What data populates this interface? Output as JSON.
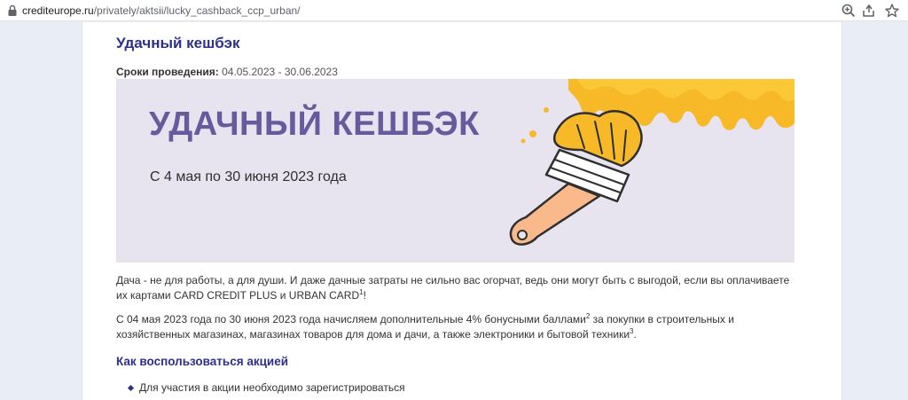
{
  "browser": {
    "url_host": "crediteurope.ru",
    "url_path": "/privately/aktsii/lucky_cashback_ccp_urban/",
    "icons": [
      "lock-icon",
      "zoom-icon",
      "share-icon",
      "star-icon"
    ]
  },
  "page": {
    "title": "Удачный кешбэк",
    "dates_label": "Сроки проведения:",
    "dates_value": "04.05.2023 - 30.06.2023",
    "banner": {
      "title": "УДАЧНЫЙ КЕШБЭК",
      "subtitle": "С 4 мая по 30 июня 2023 года",
      "colors": {
        "background": "#e7e3ef",
        "title": "#675a9d",
        "paint": "#f7b928"
      }
    },
    "paragraph1": {
      "part1": "Дача - не для работы, а для души. И даже дачные затраты не сильно вас огорчат, ведь они могут быть с выгодой, если вы оплачиваете их картами CARD CREDIT PLUS и URBAN CARD",
      "sup1": "1",
      "part2": "!"
    },
    "paragraph2": {
      "part1": "С 04 мая 2023 года по 30 июня 2023 года начисляем дополнительные 4% бонусными баллами",
      "sup1": "2",
      "part2": " за покупки в строительных и хозяйственных магазинах, магазинах товаров для дома и дачи, а также электроники и бытовой техники",
      "sup2": "3",
      "part3": "."
    },
    "section_title": "Как воспользоваться акцией",
    "list": [
      "Для участия в акции необходимо зарегистрироваться"
    ]
  }
}
